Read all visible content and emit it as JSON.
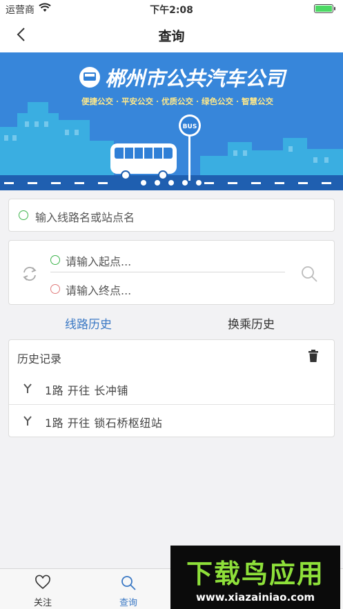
{
  "status_bar": {
    "carrier": "运营商",
    "time": "下午2:08"
  },
  "nav": {
    "title": "查询"
  },
  "banner": {
    "company_name": "郴州市公共汽车公司",
    "slogan": "便捷公交 · 平安公交 · 优质公交 · 绿色公交 · 智慧公交",
    "bus_sign": "BUS"
  },
  "search": {
    "placeholder": "输入线路名或站点名"
  },
  "route_planner": {
    "start_placeholder": "请输入起点...",
    "end_placeholder": "请输入终点..."
  },
  "tabs": [
    {
      "label": "线路历史",
      "active": true
    },
    {
      "label": "换乘历史",
      "active": false
    }
  ],
  "history": {
    "header": "历史记录",
    "items": [
      {
        "text": "1路 开往 长冲铺"
      },
      {
        "text": "1路 开往 锁石桥枢纽站"
      }
    ]
  },
  "bottom_tabs": [
    {
      "label": "关注",
      "icon": "heart-icon"
    },
    {
      "label": "查询",
      "icon": "search-icon",
      "active": true
    }
  ],
  "watermark": {
    "title": "下载鸟应用",
    "url": "www.xiazainiao.com"
  },
  "colors": {
    "accent": "#3a78c4",
    "banner_bg": "#2f7fd6",
    "start_dot": "#3cb44b",
    "end_dot": "#e07b7b"
  }
}
